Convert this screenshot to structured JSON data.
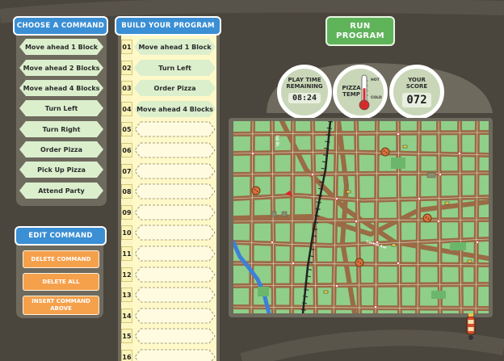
{
  "choose_panel": {
    "title": "CHOOSE A COMMAND",
    "commands": [
      "Move ahead 1 Block",
      "Move ahead 2 Blocks",
      "Move ahead 4 Blocks",
      "Turn Left",
      "Turn Right",
      "Order Pizza",
      "Pick Up Pizza",
      "Attend Party"
    ]
  },
  "edit_panel": {
    "title": "EDIT COMMAND",
    "buttons": [
      "DELETE COMMAND",
      "DELETE ALL",
      "INSERT COMMAND ABOVE"
    ]
  },
  "program_panel": {
    "title": "BUILD YOUR PROGRAM",
    "slots": [
      {
        "num": "01",
        "cmd": "Move ahead 1 Block"
      },
      {
        "num": "02",
        "cmd": "Turn Left"
      },
      {
        "num": "03",
        "cmd": "Order Pizza"
      },
      {
        "num": "04",
        "cmd": "Move ahead 4 Blocks"
      },
      {
        "num": "05",
        "cmd": ""
      },
      {
        "num": "06",
        "cmd": ""
      },
      {
        "num": "07",
        "cmd": ""
      },
      {
        "num": "08",
        "cmd": ""
      },
      {
        "num": "09",
        "cmd": ""
      },
      {
        "num": "10",
        "cmd": ""
      },
      {
        "num": "11",
        "cmd": ""
      },
      {
        "num": "12",
        "cmd": ""
      },
      {
        "num": "13",
        "cmd": ""
      },
      {
        "num": "14",
        "cmd": ""
      },
      {
        "num": "15",
        "cmd": ""
      },
      {
        "num": "16",
        "cmd": ""
      }
    ]
  },
  "run_button": {
    "line1": "RUN",
    "line2": "PROGRAM"
  },
  "gauges": {
    "time": {
      "label1": "PLAY TIME",
      "label2": "REMAINING",
      "value": "08:24"
    },
    "temp": {
      "label1": "PIZZA",
      "label2": "TEMP",
      "hot": "HOT",
      "cold": "COLD",
      "level": 0.55
    },
    "score": {
      "label1": "YOUR",
      "label2": "SCORE",
      "value": "072"
    }
  },
  "map": {
    "street_labels": [
      "1st St.",
      "Central Ave"
    ],
    "colors": {
      "block": "#8fcf8a",
      "street": "#9a6b45",
      "water": "#3d7fd9",
      "rail": "#222222",
      "pizza": "#d8703a"
    }
  },
  "colors": {
    "background": "#4a453d",
    "panel": "#6e6a5d",
    "title_blue": "#3b8fd4",
    "run_green": "#5fb45a",
    "edit_orange": "#f5a04b",
    "command_green": "#dbefcd"
  }
}
